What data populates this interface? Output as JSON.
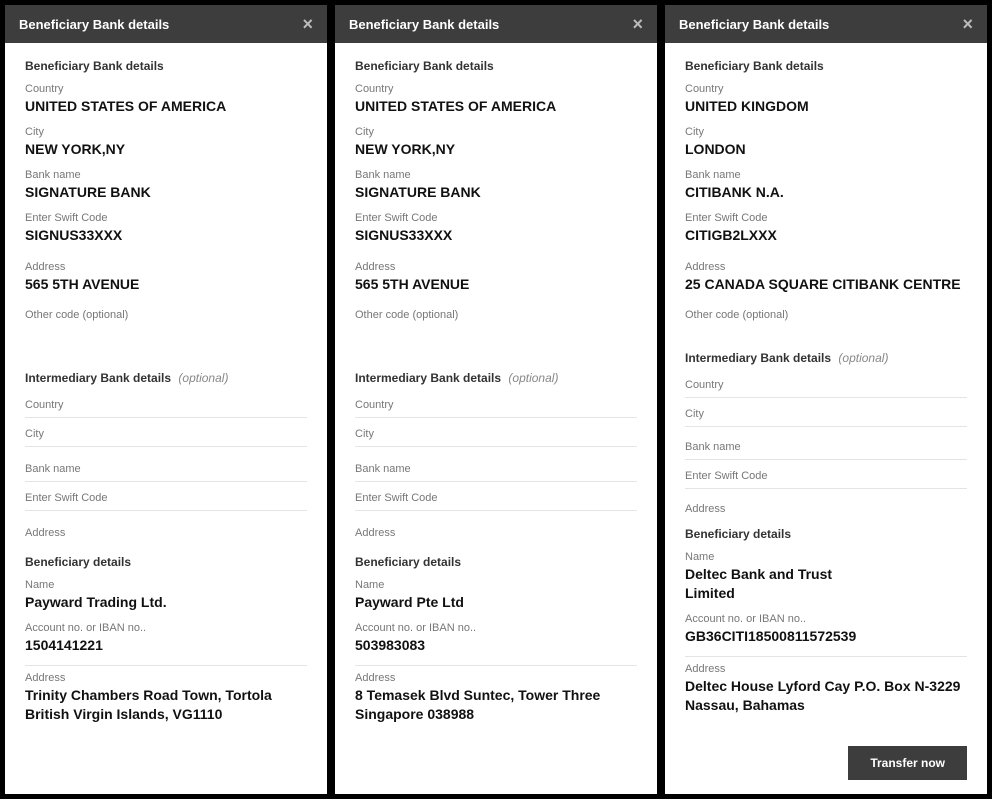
{
  "shared": {
    "header_title": "Beneficiary Bank details",
    "section_bank": "Beneficiary Bank details",
    "section_intermediary": "Intermediary Bank details",
    "section_beneficiary": "Beneficiary details",
    "optional": "(optional)",
    "labels": {
      "country": "Country",
      "city": "City",
      "bank_name": "Bank name",
      "swift": "Enter Swift Code",
      "address": "Address",
      "other_code": "Other code (optional)",
      "name": "Name",
      "account": "Account no. or IBAN no.."
    },
    "transfer_btn": "Transfer now"
  },
  "panels": [
    {
      "bank": {
        "country": "UNITED STATES OF AMERICA",
        "city": "NEW YORK,NY",
        "bank_name": "SIGNATURE BANK",
        "swift": "SIGNUS33XXX",
        "address": "565 5TH AVENUE",
        "other_code": ""
      },
      "beneficiary": {
        "name": "Payward Trading Ltd.",
        "account": "1504141221",
        "address": "Trinity Chambers Road Town, Tortola British Virgin Islands, VG1110"
      }
    },
    {
      "bank": {
        "country": "UNITED STATES OF AMERICA",
        "city": "NEW YORK,NY",
        "bank_name": "SIGNATURE BANK",
        "swift": "SIGNUS33XXX",
        "address": "565 5TH AVENUE",
        "other_code": ""
      },
      "beneficiary": {
        "name": "Payward Pte Ltd",
        "account": "503983083",
        "address": "8 Temasek Blvd Suntec, Tower Three Singapore 038988"
      }
    },
    {
      "bank": {
        "country": "UNITED KINGDOM",
        "city": "LONDON",
        "bank_name": "CITIBANK N.A.",
        "swift": "CITIGB2LXXX",
        "address": "25 CANADA SQUARE CITIBANK CENTRE",
        "other_code": ""
      },
      "beneficiary": {
        "name": "Deltec Bank and Trust Limited",
        "account": "GB36CITI18500811572539",
        "address": "Deltec House Lyford Cay P.O. Box N-3229 Nassau, Bahamas"
      },
      "show_footer": true
    }
  ]
}
